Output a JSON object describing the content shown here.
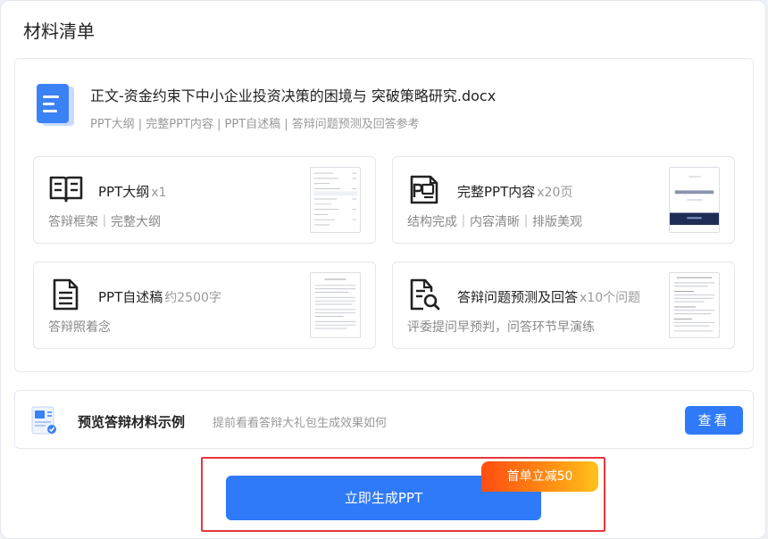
{
  "header": {
    "title": "材料清单"
  },
  "document": {
    "filename": "正文-资金约束下中小企业投资决策的困境与 突破策略研究.docx",
    "tags": "PPT大纲 | 完整PPT内容 | PPT自述稿 | 答辩问题预测及回答参考"
  },
  "cards": [
    {
      "name": "PPT大纲",
      "qty": "x1",
      "desc": "答辩框架｜完整大纲",
      "icon": "book-icon"
    },
    {
      "name": "完整PPT内容",
      "qty": "x20页",
      "desc": "结构完成｜内容清晰｜排版美观",
      "icon": "ppt-file-icon"
    },
    {
      "name": "PPT自述稿",
      "qty": "约2500字",
      "desc": "答辩照着念",
      "icon": "document-lines-icon"
    },
    {
      "name": "答辩问题预测及回答",
      "qty": "x10个问题",
      "desc": "评委提问早预判，问答环节早演练",
      "icon": "document-search-icon"
    }
  ],
  "preview": {
    "title": "预览答辩材料示例",
    "subtitle": "提前看看答辩大礼包生成效果如何",
    "button": "查看",
    "icon": "preview-doc-icon"
  },
  "cta": {
    "button": "立即生成PPT",
    "badge": "首单立减50"
  },
  "colors": {
    "accent": "#2f7af8",
    "highlight_border": "#e8363a",
    "badge_gradient_start": "#ff4d10",
    "badge_gradient_end": "#ffc21a"
  }
}
